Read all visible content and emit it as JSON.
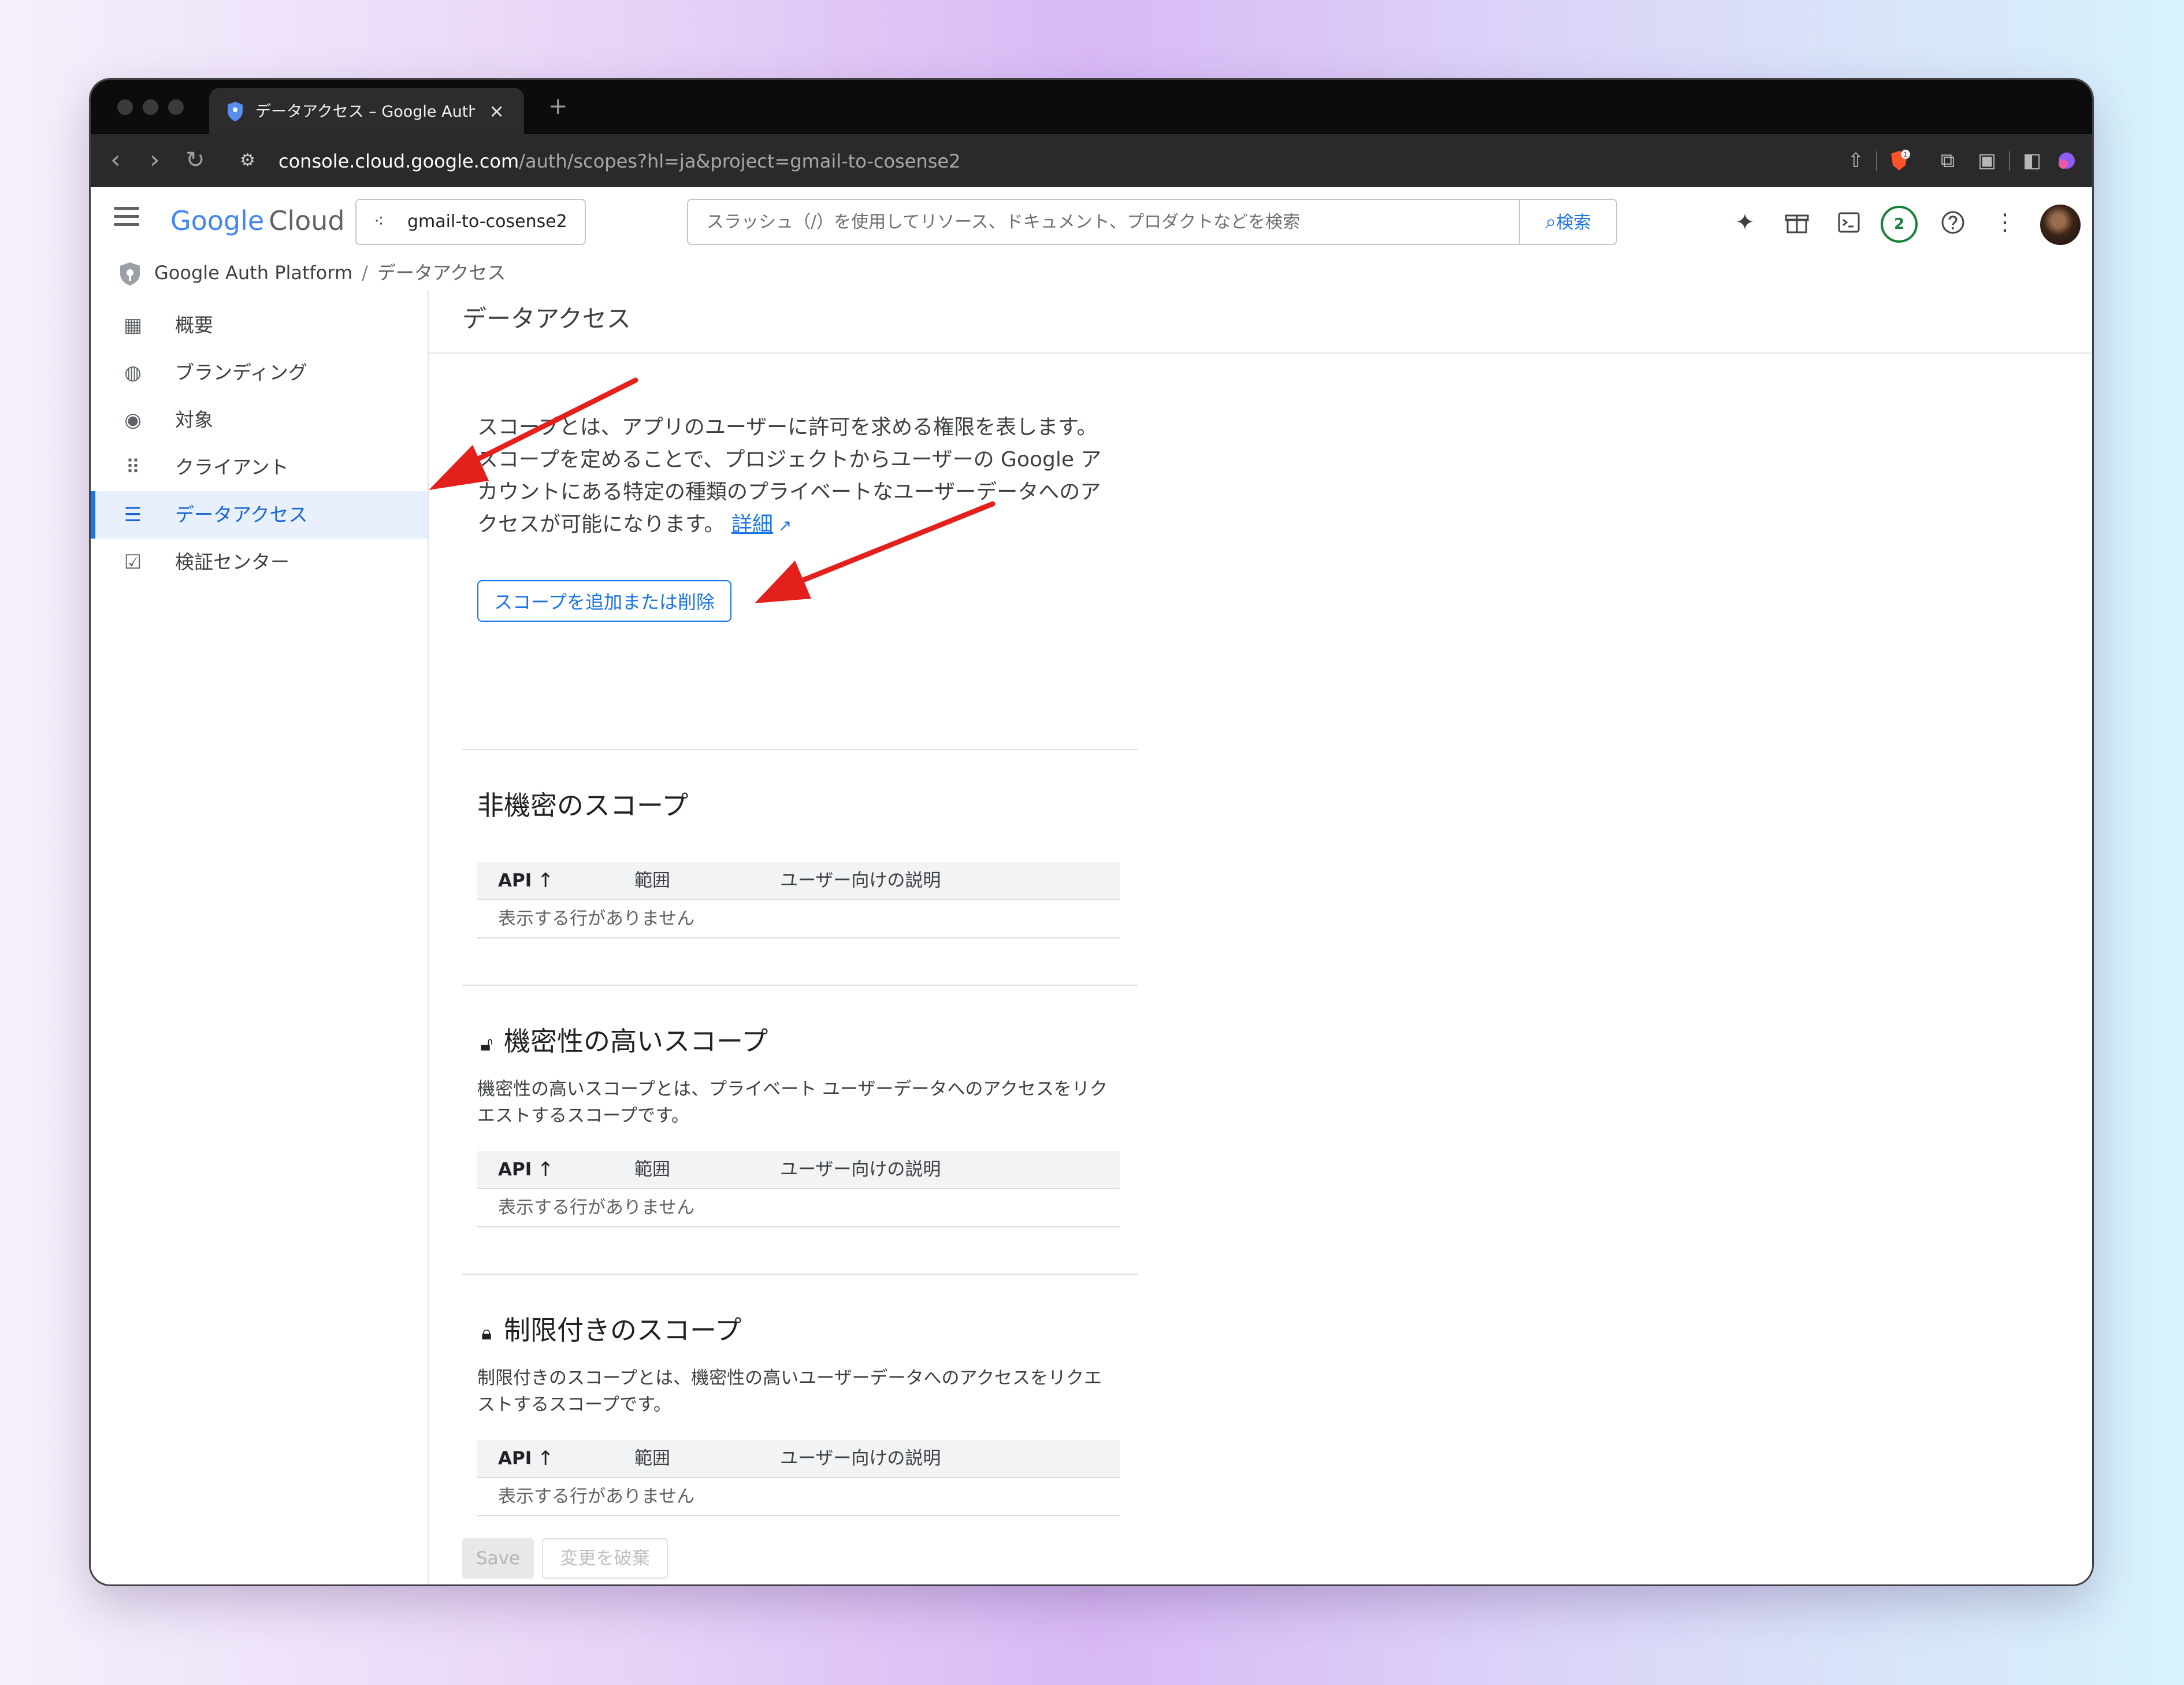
{
  "browser": {
    "tab_title": "データアクセス – Google Auth Platform",
    "tab_close": "×",
    "new_tab": "+",
    "url_host": "console.cloud.google.com",
    "url_path": "/auth/scopes?hl=ja&project=gmail-to-cosense2",
    "brave_badge": "1"
  },
  "header": {
    "logo_google": "Google",
    "logo_cloud": "Cloud",
    "project": "gmail-to-cosense2",
    "search_placeholder": "スラッシュ（/）を使用してリソース、ドキュメント、プロダクトなどを検索",
    "search_button": "検索",
    "notifications_count": "2"
  },
  "breadcrumb": {
    "root": "Google Auth Platform",
    "separator": "/",
    "current": "データアクセス"
  },
  "sidebar": {
    "items": [
      {
        "label": "概要",
        "icon": "dashboard-icon"
      },
      {
        "label": "ブランディング",
        "icon": "palette-icon"
      },
      {
        "label": "対象",
        "icon": "account-circle-icon"
      },
      {
        "label": "クライアント",
        "icon": "apps-grid-icon"
      },
      {
        "label": "データアクセス",
        "icon": "data-access-icon",
        "active": true
      },
      {
        "label": "検証センター",
        "icon": "verified-icon"
      }
    ],
    "collapse": "<I"
  },
  "main": {
    "title": "データアクセス",
    "intro": "スコープとは、アプリのユーザーに許可を求める権限を表します。スコープを定めることで、プロジェクトからユーザーの Google アカウントにある特定の種類のプライベートなユーザーデータへのアクセスが可能になります。",
    "intro_link": "詳細",
    "add_scope_button": "スコープを追加または削除",
    "table_headers": {
      "api": "API",
      "range": "範囲",
      "desc": "ユーザー向けの説明"
    },
    "empty_text": "表示する行がありません",
    "sections": [
      {
        "title": "非機密のスコープ",
        "description": ""
      },
      {
        "title": "機密性の高いスコープ",
        "description": "機密性の高いスコープとは、プライベート ユーザーデータへのアクセスをリクエストするスコープです。"
      },
      {
        "title": "制限付きのスコープ",
        "description": "制限付きのスコープとは、機密性の高いユーザーデータへのアクセスをリクエストするスコープです。"
      }
    ],
    "save_button": "Save",
    "discard_button": "変更を破棄"
  },
  "colors": {
    "accent": "#1a73e8",
    "annotation_arrow": "#e4201c",
    "notification_ring": "#188038"
  }
}
